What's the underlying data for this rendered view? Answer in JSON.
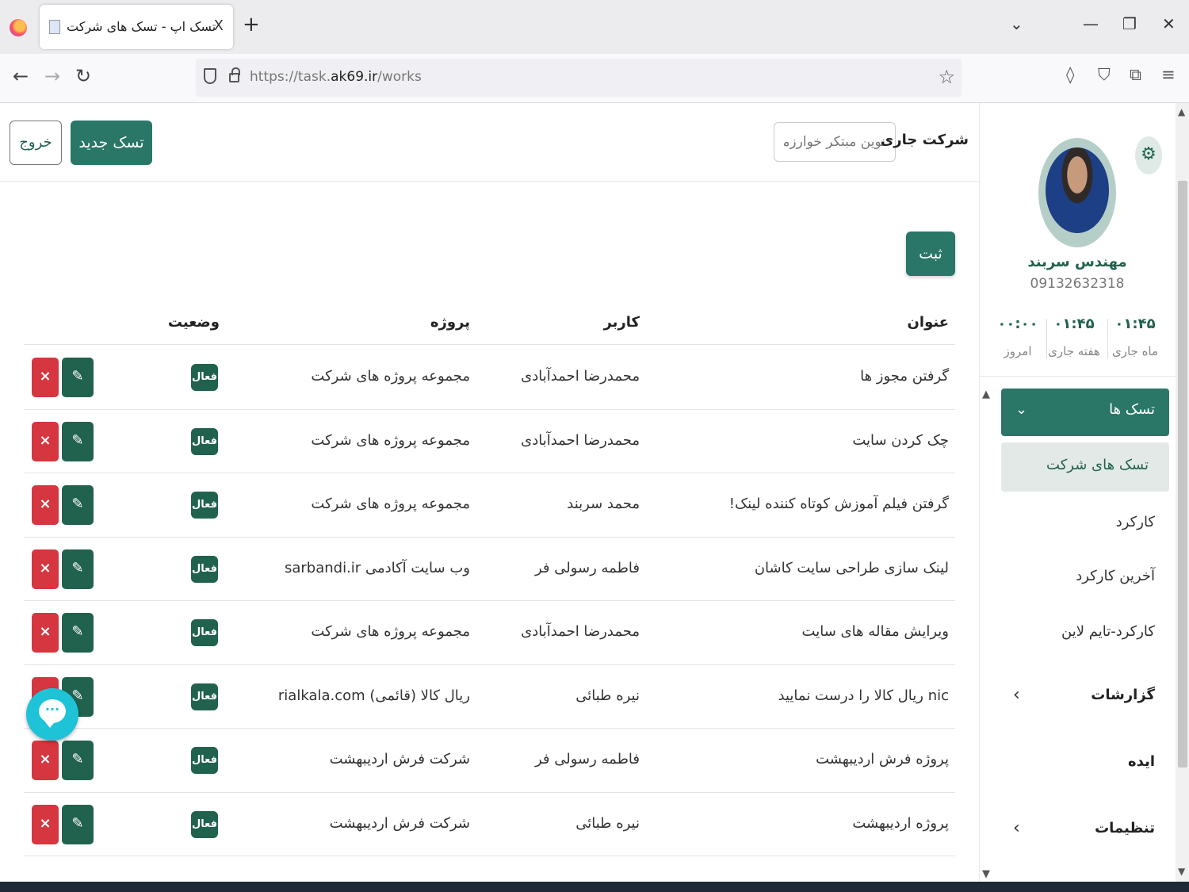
{
  "browser": {
    "tab_title": "تسک اپ - تسک های شرکت",
    "tab_close": "X",
    "new_tab": "+",
    "url_prefix": "https://task.",
    "url_domain": "ak69.ir",
    "url_path": "/works",
    "icons": [
      "firefox-icon",
      "back-icon",
      "forward-icon",
      "reload-icon",
      "shield-icon",
      "lock-icon",
      "bookmark-star-icon",
      "pocket-icon",
      "vpn-icon",
      "extensions-icon",
      "menu-icon"
    ]
  },
  "header": {
    "logout_label": "خروج",
    "new_task_label": "تسک جدید",
    "company_label": "شرکت جاری",
    "company_value": "نوین مبتکر خوارزمی"
  },
  "table": {
    "submit_label": "ثبت",
    "columns": {
      "title": "عنوان",
      "user": "کاربر",
      "project": "پروژه",
      "status": "وضعیت"
    },
    "rows": [
      {
        "title": "گرفتن مجوز ها",
        "user": "محمدرضا احمدآبادی",
        "project": "مجموعه پروژه های شرکت",
        "status": "فعال"
      },
      {
        "title": "چک کردن سایت",
        "user": "محمدرضا احمدآبادی",
        "project": "مجموعه پروژه های شرکت",
        "status": "فعال"
      },
      {
        "title": "گرفتن فیلم آموزش کوتاه کننده لینک!",
        "user": "محمد سربند",
        "project": "مجموعه پروژه های شرکت",
        "status": "فعال"
      },
      {
        "title": "لینک سازی طراحی سایت کاشان",
        "user": "فاطمه رسولی فر",
        "project": "وب سایت آکادمی sarbandi.ir",
        "status": "فعال"
      },
      {
        "title": "ویرایش مقاله های سایت",
        "user": "محمدرضا احمدآبادی",
        "project": "مجموعه پروژه های شرکت",
        "status": "فعال"
      },
      {
        "title": "nic ریال کالا را درست نمایید",
        "user": "نیره طبائی",
        "project": "ریال کالا (قائمی) rialkala.com",
        "status": "فعال"
      },
      {
        "title": "پروژه فرش اردیبهشت",
        "user": "فاطمه رسولی فر",
        "project": "شرکت فرش اردیبهشت",
        "status": "فعال"
      },
      {
        "title": "پروژه اردیبهشت",
        "user": "نیره طبائی",
        "project": "شرکت فرش اردیبهشت",
        "status": "فعال"
      }
    ],
    "delete_label": "×",
    "edit_label": "✎"
  },
  "sidebar": {
    "user_name": "مهندس سربند",
    "user_phone": "09132632318",
    "stats": [
      {
        "value": "۰۱:۴۵",
        "label": "ماه جاری"
      },
      {
        "value": "۰۱:۴۵",
        "label": "هفته جاری"
      },
      {
        "value": "۰۰:۰۰",
        "label": "امروز"
      }
    ],
    "menu_tasks": "تسک ها",
    "menu_company_tasks": "تسک های شرکت",
    "menu_work": "کارکرد",
    "menu_last_work": "آخرین کارکرد",
    "menu_timeline": "کارکرد-تایم لاین",
    "menu_reports": "گزارشات",
    "menu_idea": "ایده",
    "menu_settings": "تنظیمات"
  },
  "colors": {
    "primary": "#2a7767",
    "danger": "#d6363f",
    "chat": "#1ec3d8"
  }
}
